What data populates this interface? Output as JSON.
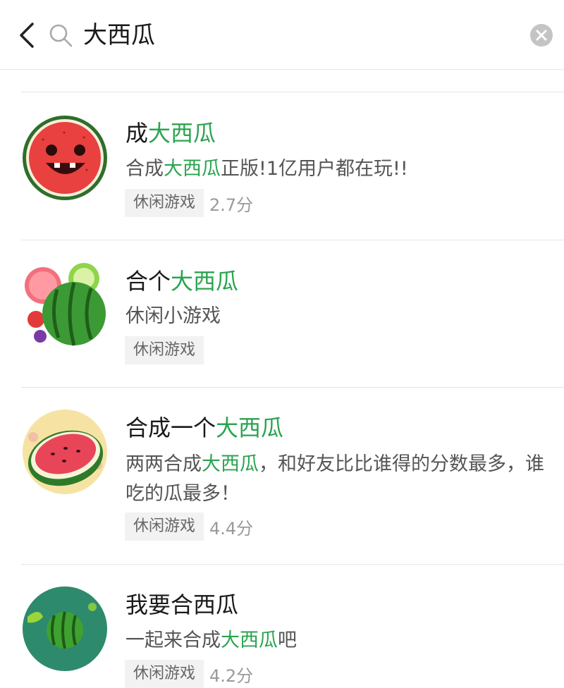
{
  "search": {
    "query": "大西瓜"
  },
  "results": [
    {
      "title_parts": [
        "成",
        "大西瓜",
        ""
      ],
      "desc_parts": [
        "合成",
        "大西瓜",
        "正版!1亿用户都在玩!!"
      ],
      "tag": "休闲游戏",
      "score": "2.7分",
      "icon": "angry-watermelon-face-icon"
    },
    {
      "title_parts": [
        "合个",
        "大西瓜",
        ""
      ],
      "desc_parts": [
        "休闲小游戏",
        "",
        ""
      ],
      "tag": "休闲游戏",
      "score": "",
      "icon": "fruit-cluster-watermelon-icon"
    },
    {
      "title_parts": [
        "合成一个",
        "大西瓜",
        ""
      ],
      "desc_parts": [
        "两两合成",
        "大西瓜",
        "，和好友比比谁得的分数最多，谁吃的瓜最多！"
      ],
      "tag": "休闲游戏",
      "score": "4.4分",
      "icon": "sliced-watermelon-icon"
    },
    {
      "title_parts": [
        "我要合西瓜",
        "",
        ""
      ],
      "desc_parts": [
        "一起来合成",
        "大西瓜",
        "吧"
      ],
      "tag": "休闲游戏",
      "score": "4.2分",
      "icon": "watermelon-ball-icon"
    }
  ],
  "colors": {
    "highlight": "#2aa44f",
    "divider": "#e6e6e6"
  }
}
